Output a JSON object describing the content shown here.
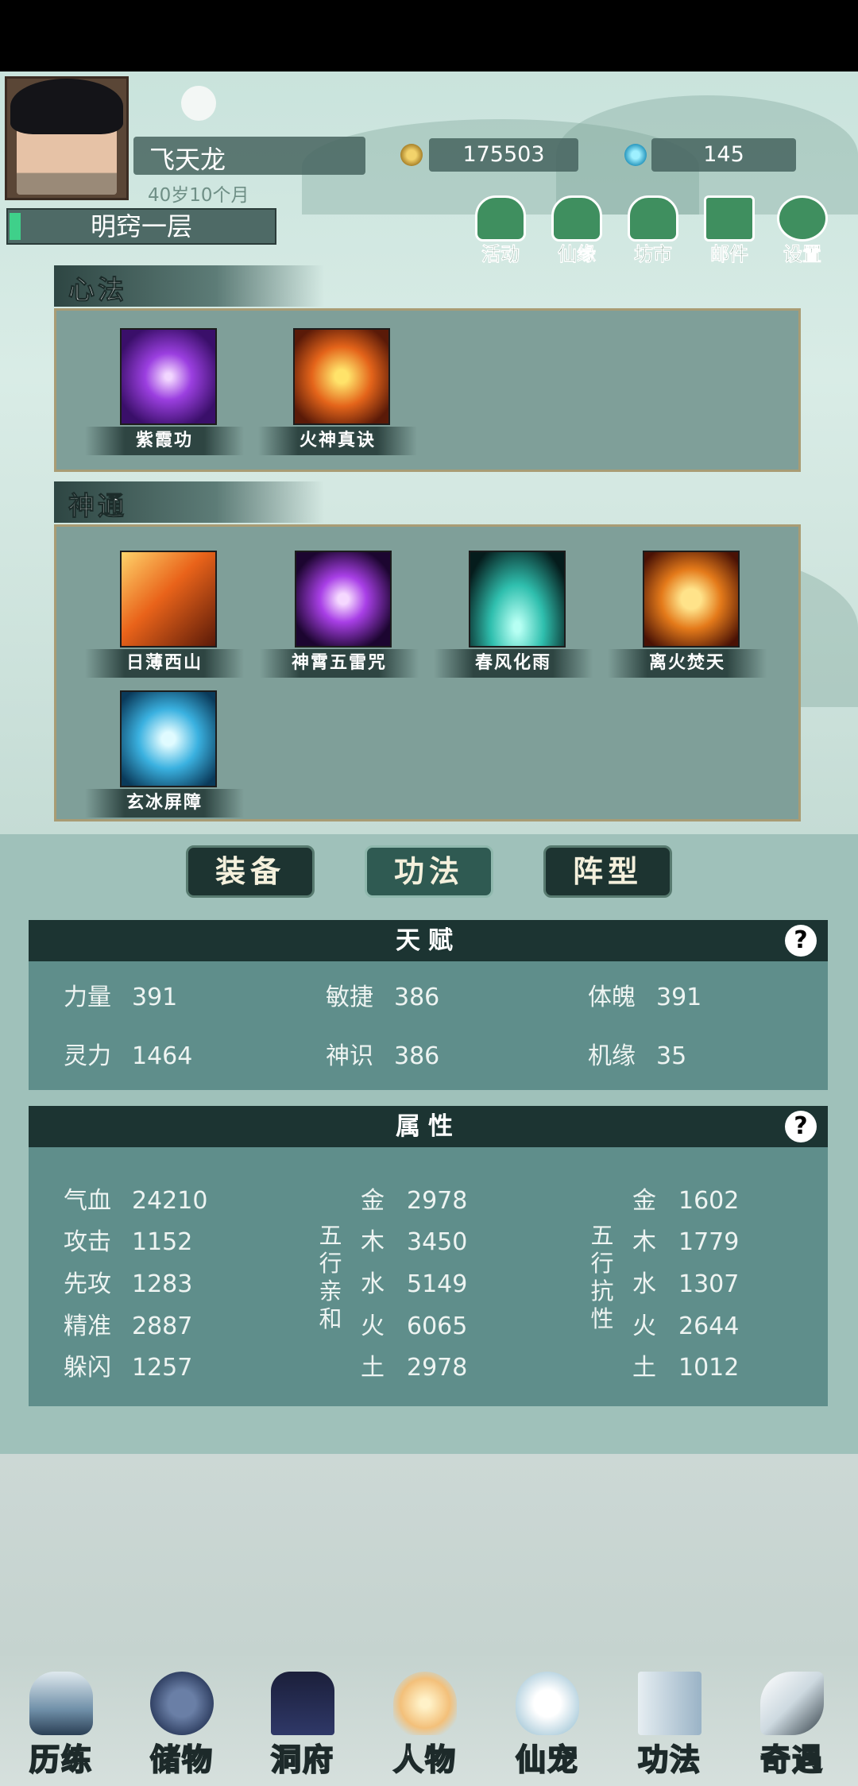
{
  "player": {
    "name": "飞天龙",
    "age": "40岁10个月",
    "realm": "明窍一层",
    "coins": "175503",
    "gems": "145"
  },
  "top_menu": [
    {
      "label": "活动",
      "icon": "activity-icon"
    },
    {
      "label": "仙缘",
      "icon": "fate-icon"
    },
    {
      "label": "坊市",
      "icon": "market-icon"
    },
    {
      "label": "邮件",
      "icon": "mail-icon"
    },
    {
      "label": "设置",
      "icon": "settings-gear-icon"
    }
  ],
  "xinfa": {
    "title": "心法",
    "skills": [
      {
        "label": "紫霞功",
        "color": "#7a2fb0"
      },
      {
        "label": "火神真诀",
        "color": "#d9731a"
      }
    ]
  },
  "shentong": {
    "title": "神通",
    "skills": [
      {
        "label": "日薄西山",
        "color": "#e0701a"
      },
      {
        "label": "神霄五雷咒",
        "color": "#9b2fd6"
      },
      {
        "label": "春风化雨",
        "color": "#2fb8a8"
      },
      {
        "label": "离火焚天",
        "color": "#e08a1a"
      },
      {
        "label": "玄冰屏障",
        "color": "#3aa6d6"
      }
    ]
  },
  "tabs": [
    {
      "label": "装备",
      "active": false
    },
    {
      "label": "功法",
      "active": true
    },
    {
      "label": "阵型",
      "active": false
    }
  ],
  "talent": {
    "title": "天赋",
    "help": "?",
    "items": [
      {
        "label": "力量",
        "value": "391"
      },
      {
        "label": "敏捷",
        "value": "386"
      },
      {
        "label": "体魄",
        "value": "391"
      },
      {
        "label": "灵力",
        "value": "1464"
      },
      {
        "label": "神识",
        "value": "386"
      },
      {
        "label": "机缘",
        "value": "35"
      }
    ]
  },
  "attributes": {
    "title": "属性",
    "help": "?",
    "basic": [
      {
        "label": "气血",
        "value": "24210"
      },
      {
        "label": "攻击",
        "value": "1152"
      },
      {
        "label": "先攻",
        "value": "1283"
      },
      {
        "label": "精准",
        "value": "2887"
      },
      {
        "label": "躲闪",
        "value": "1257"
      }
    ],
    "affinity_label": [
      "五",
      "行",
      "亲",
      "和"
    ],
    "affinity": [
      {
        "label": "金",
        "value": "2978"
      },
      {
        "label": "木",
        "value": "3450"
      },
      {
        "label": "水",
        "value": "5149"
      },
      {
        "label": "火",
        "value": "6065"
      },
      {
        "label": "土",
        "value": "2978"
      }
    ],
    "resist_label": [
      "五",
      "行",
      "抗",
      "性"
    ],
    "resist": [
      {
        "label": "金",
        "value": "1602"
      },
      {
        "label": "木",
        "value": "1779"
      },
      {
        "label": "水",
        "value": "1307"
      },
      {
        "label": "火",
        "value": "2644"
      },
      {
        "label": "土",
        "value": "1012"
      }
    ]
  },
  "bottom_nav": [
    {
      "label": "历练",
      "icon": "mountain-icon"
    },
    {
      "label": "储物",
      "icon": "bag-icon"
    },
    {
      "label": "洞府",
      "icon": "pavilion-icon"
    },
    {
      "label": "人物",
      "icon": "character-icon"
    },
    {
      "label": "仙宠",
      "icon": "pet-icon"
    },
    {
      "label": "功法",
      "icon": "scroll-book-icon"
    },
    {
      "label": "奇遇",
      "icon": "brush-icon"
    }
  ]
}
